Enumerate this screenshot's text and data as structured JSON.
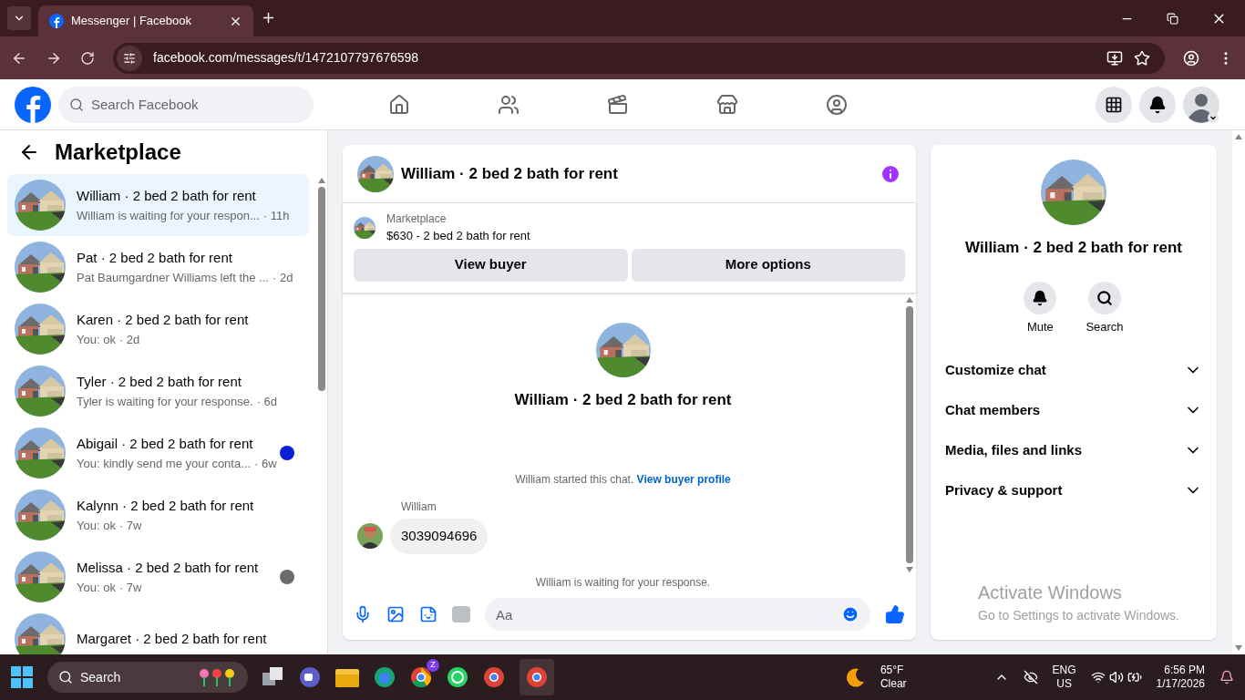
{
  "browser": {
    "tab_title": "Messenger | Facebook",
    "url": "facebook.com/messages/t/1472107797676598"
  },
  "facebook": {
    "search_placeholder": "Search Facebook"
  },
  "sidebar": {
    "title": "Marketplace",
    "conversations": [
      {
        "title": "William · 2 bed 2 bath for rent",
        "preview": "William is waiting for your respon...",
        "time": "· 11h",
        "selected": true
      },
      {
        "title": "Pat · 2 bed 2 bath for rent",
        "preview": "Pat Baumgardner Williams left the ...",
        "time": "· 2d",
        "selected": false
      },
      {
        "title": "Karen · 2 bed 2 bath for rent",
        "preview": "You: ok",
        "time": "· 2d",
        "selected": false
      },
      {
        "title": "Tyler · 2 bed 2 bath for rent",
        "preview": "Tyler is waiting for your response.",
        "time": "· 6d",
        "selected": false
      },
      {
        "title": "Abigail · 2 bed 2 bath for rent",
        "preview": "You: kindly send me your conta...",
        "time": "· 6w",
        "selected": false,
        "color": "#0a1fd8"
      },
      {
        "title": "Kalynn · 2 bed 2 bath for rent",
        "preview": "You: ok",
        "time": "· 7w",
        "selected": false
      },
      {
        "title": "Melissa · 2 bed 2 bath for rent",
        "preview": "You: ok",
        "time": "· 7w",
        "selected": false,
        "color": "#6b6b6b"
      },
      {
        "title": "Margaret · 2 bed 2 bath for rent",
        "selected": false
      }
    ]
  },
  "chat": {
    "title": "William · 2 bed 2 bath for rent",
    "listing": {
      "label": "Marketplace",
      "name": "$630 - 2 bed 2 bath for rent"
    },
    "buttons": [
      "View buyer",
      "More options"
    ],
    "intro_title": "William · 2 bed 2 bath for rent",
    "note": {
      "text": "William started this chat.",
      "link": "View buyer profile"
    },
    "messages": [
      {
        "sender": "William",
        "text": "3039094696"
      }
    ],
    "status": "William is waiting for your response.",
    "composer": {
      "placeholder": "Aa"
    }
  },
  "details": {
    "title": "William · 2 bed 2 bath for rent",
    "actions": [
      {
        "kind": "mute",
        "label": "Mute"
      },
      {
        "kind": "search",
        "label": "Search"
      }
    ],
    "sections": [
      {
        "label": "Customize chat",
        "expanded": false
      },
      {
        "label": "Chat members",
        "expanded": false
      },
      {
        "label": "Media, files and links",
        "expanded": false
      },
      {
        "label": "Privacy & support",
        "expanded": false
      }
    ]
  },
  "activation_notice": {
    "title": "Activate Windows",
    "text": "Go to Settings to activate Windows."
  },
  "taskbar": {
    "search_placeholder": "Search",
    "chrome_badge": "Z",
    "weather": {
      "temperature": "65°F",
      "condition": "Clear"
    },
    "language": "ENG",
    "region": "US",
    "time": "6:56 PM",
    "date": "1/17/2026"
  }
}
